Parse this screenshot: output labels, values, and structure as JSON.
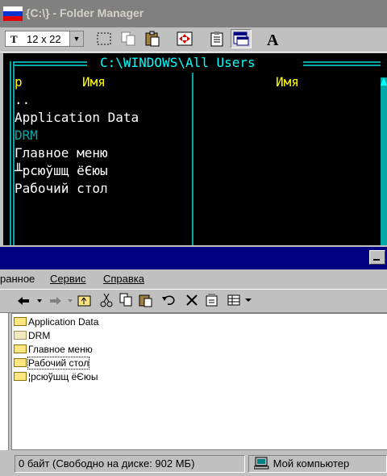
{
  "top_window": {
    "title": "{C:\\} - Folder Manager",
    "font_size_value": "12 x 22",
    "font_icon_text": "T",
    "toolbar_icons": [
      "mark-icon",
      "copy-icon",
      "paste-icon",
      "fullscreen-icon",
      "properties-icon",
      "background-icon",
      "font-icon"
    ],
    "dos": {
      "path_header": "C:\\WINDOWS\\All Users",
      "col_left_p": "р",
      "col_left_name": "Имя",
      "col_right_name": "Имя",
      "items": [
        {
          "text": "..",
          "color": "white"
        },
        {
          "text": "Application Data",
          "color": "white"
        },
        {
          "text": "DRM",
          "color": "teal"
        },
        {
          "text": "Главное меню",
          "color": "white"
        },
        {
          "text": "╨рсюўшщ ёЄюы",
          "color": "white"
        },
        {
          "text": "Рабочий стол",
          "color": "white"
        }
      ]
    }
  },
  "second_window": {
    "menu": [
      "ранное",
      "Сервис",
      "Справка"
    ],
    "toolbar_icons": [
      "back-icon",
      "forward-icon",
      "up-icon",
      "cut-icon",
      "copy-icon",
      "paste-icon",
      "undo-icon",
      "delete-icon",
      "properties-icon",
      "views-icon"
    ],
    "list_items": [
      {
        "label": "Application Data",
        "light": false,
        "selected": false
      },
      {
        "label": "DRM",
        "light": true,
        "selected": false
      },
      {
        "label": "Главное меню",
        "light": false,
        "selected": false
      },
      {
        "label": "Рабочий стол",
        "light": false,
        "selected": true
      },
      {
        "label": "¦рсюўшщ ёЄюы",
        "light": false,
        "selected": false
      }
    ],
    "status_left": "0 байт (Свободно на диске: 902 МБ)",
    "status_right": "Мой компьютер"
  },
  "colors": {
    "dos_bg": "#000000",
    "dos_frame": "#00a8a8",
    "dos_cyan": "#00ffff",
    "dos_yellow": "#ffff00",
    "title_active": "#000080",
    "title_inactive": "#808080"
  }
}
